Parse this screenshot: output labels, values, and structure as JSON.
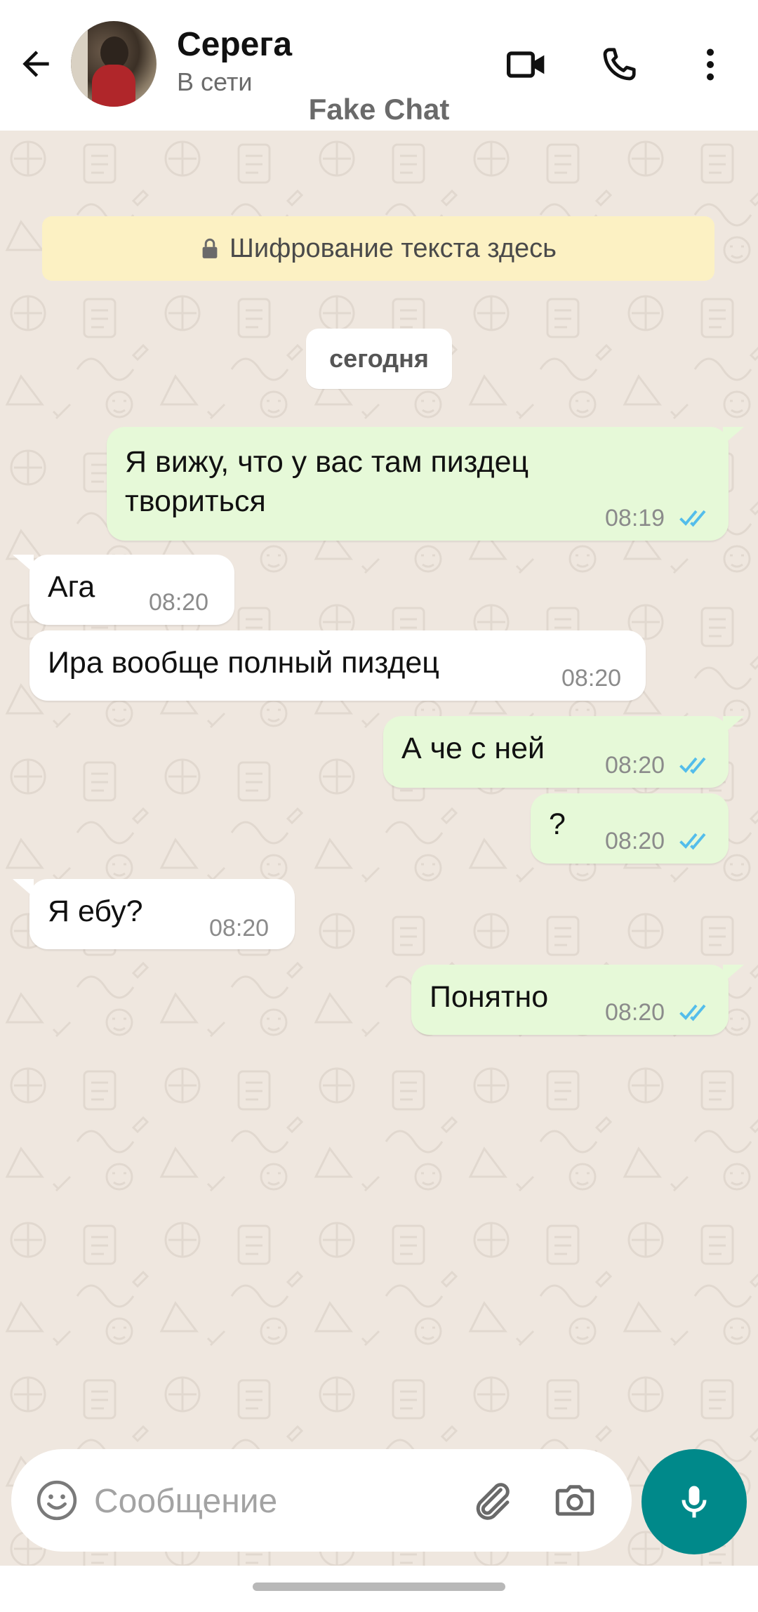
{
  "header": {
    "contact_name": "Серега",
    "status": "В сети",
    "watermark": "Fake Chat"
  },
  "chat": {
    "encryption_notice": "Шифрование текста здесь",
    "date_separator": "сегодня",
    "messages": [
      {
        "direction": "out",
        "lines": [
          "Я вижу, что у вас там пиздец",
          "твориться"
        ],
        "time": "08:19",
        "status": "read"
      },
      {
        "direction": "in",
        "lines": [
          "Ага"
        ],
        "time": "08:20"
      },
      {
        "direction": "in",
        "lines": [
          "Ира вообще полный пиздец"
        ],
        "time": "08:20"
      },
      {
        "direction": "out",
        "lines": [
          "А че с ней"
        ],
        "time": "08:20",
        "status": "read"
      },
      {
        "direction": "out",
        "lines": [
          "?"
        ],
        "time": "08:20",
        "status": "read"
      },
      {
        "direction": "in",
        "lines": [
          "Я ебу?"
        ],
        "time": "08:20"
      },
      {
        "direction": "out",
        "lines": [
          "Понятно"
        ],
        "time": "08:20",
        "status": "read"
      }
    ]
  },
  "input": {
    "placeholder": "Сообщение"
  },
  "icons": {
    "back": "arrow-left-icon",
    "video": "video-camera-icon",
    "call": "phone-icon",
    "menu": "more-vertical-icon",
    "lock": "lock-icon",
    "read_receipt": "double-check-icon",
    "emoji": "emoji-icon",
    "attach": "paperclip-icon",
    "camera": "camera-icon",
    "mic": "microphone-icon"
  },
  "colors": {
    "chat_background": "#efe7df",
    "outgoing_bubble": "#e6f9d8",
    "incoming_bubble": "#ffffff",
    "encryption_banner": "#fcf1c3",
    "read_tick": "#53bdeb",
    "mic_button": "#00898a"
  }
}
